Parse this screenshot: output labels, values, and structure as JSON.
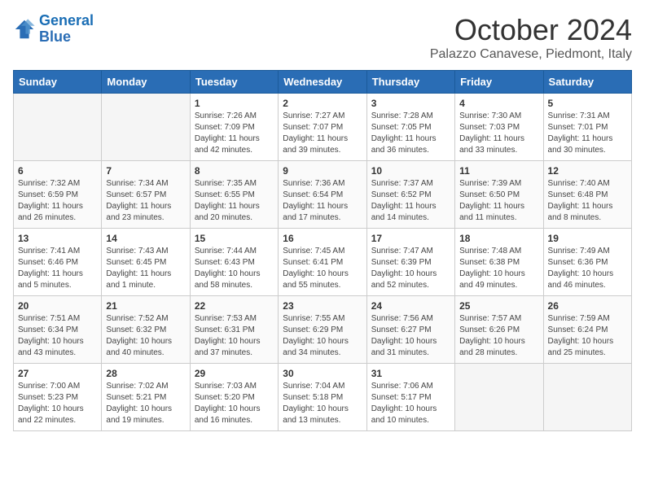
{
  "header": {
    "logo_line1": "General",
    "logo_line2": "Blue",
    "month": "October 2024",
    "location": "Palazzo Canavese, Piedmont, Italy"
  },
  "days_of_week": [
    "Sunday",
    "Monday",
    "Tuesday",
    "Wednesday",
    "Thursday",
    "Friday",
    "Saturday"
  ],
  "weeks": [
    [
      {
        "num": "",
        "empty": true
      },
      {
        "num": "",
        "empty": true
      },
      {
        "num": "1",
        "sunrise": "7:26 AM",
        "sunset": "7:09 PM",
        "daylight": "11 hours and 42 minutes."
      },
      {
        "num": "2",
        "sunrise": "7:27 AM",
        "sunset": "7:07 PM",
        "daylight": "11 hours and 39 minutes."
      },
      {
        "num": "3",
        "sunrise": "7:28 AM",
        "sunset": "7:05 PM",
        "daylight": "11 hours and 36 minutes."
      },
      {
        "num": "4",
        "sunrise": "7:30 AM",
        "sunset": "7:03 PM",
        "daylight": "11 hours and 33 minutes."
      },
      {
        "num": "5",
        "sunrise": "7:31 AM",
        "sunset": "7:01 PM",
        "daylight": "11 hours and 30 minutes."
      }
    ],
    [
      {
        "num": "6",
        "sunrise": "7:32 AM",
        "sunset": "6:59 PM",
        "daylight": "11 hours and 26 minutes."
      },
      {
        "num": "7",
        "sunrise": "7:34 AM",
        "sunset": "6:57 PM",
        "daylight": "11 hours and 23 minutes."
      },
      {
        "num": "8",
        "sunrise": "7:35 AM",
        "sunset": "6:55 PM",
        "daylight": "11 hours and 20 minutes."
      },
      {
        "num": "9",
        "sunrise": "7:36 AM",
        "sunset": "6:54 PM",
        "daylight": "11 hours and 17 minutes."
      },
      {
        "num": "10",
        "sunrise": "7:37 AM",
        "sunset": "6:52 PM",
        "daylight": "11 hours and 14 minutes."
      },
      {
        "num": "11",
        "sunrise": "7:39 AM",
        "sunset": "6:50 PM",
        "daylight": "11 hours and 11 minutes."
      },
      {
        "num": "12",
        "sunrise": "7:40 AM",
        "sunset": "6:48 PM",
        "daylight": "11 hours and 8 minutes."
      }
    ],
    [
      {
        "num": "13",
        "sunrise": "7:41 AM",
        "sunset": "6:46 PM",
        "daylight": "11 hours and 5 minutes."
      },
      {
        "num": "14",
        "sunrise": "7:43 AM",
        "sunset": "6:45 PM",
        "daylight": "11 hours and 1 minute."
      },
      {
        "num": "15",
        "sunrise": "7:44 AM",
        "sunset": "6:43 PM",
        "daylight": "10 hours and 58 minutes."
      },
      {
        "num": "16",
        "sunrise": "7:45 AM",
        "sunset": "6:41 PM",
        "daylight": "10 hours and 55 minutes."
      },
      {
        "num": "17",
        "sunrise": "7:47 AM",
        "sunset": "6:39 PM",
        "daylight": "10 hours and 52 minutes."
      },
      {
        "num": "18",
        "sunrise": "7:48 AM",
        "sunset": "6:38 PM",
        "daylight": "10 hours and 49 minutes."
      },
      {
        "num": "19",
        "sunrise": "7:49 AM",
        "sunset": "6:36 PM",
        "daylight": "10 hours and 46 minutes."
      }
    ],
    [
      {
        "num": "20",
        "sunrise": "7:51 AM",
        "sunset": "6:34 PM",
        "daylight": "10 hours and 43 minutes."
      },
      {
        "num": "21",
        "sunrise": "7:52 AM",
        "sunset": "6:32 PM",
        "daylight": "10 hours and 40 minutes."
      },
      {
        "num": "22",
        "sunrise": "7:53 AM",
        "sunset": "6:31 PM",
        "daylight": "10 hours and 37 minutes."
      },
      {
        "num": "23",
        "sunrise": "7:55 AM",
        "sunset": "6:29 PM",
        "daylight": "10 hours and 34 minutes."
      },
      {
        "num": "24",
        "sunrise": "7:56 AM",
        "sunset": "6:27 PM",
        "daylight": "10 hours and 31 minutes."
      },
      {
        "num": "25",
        "sunrise": "7:57 AM",
        "sunset": "6:26 PM",
        "daylight": "10 hours and 28 minutes."
      },
      {
        "num": "26",
        "sunrise": "7:59 AM",
        "sunset": "6:24 PM",
        "daylight": "10 hours and 25 minutes."
      }
    ],
    [
      {
        "num": "27",
        "sunrise": "7:00 AM",
        "sunset": "5:23 PM",
        "daylight": "10 hours and 22 minutes."
      },
      {
        "num": "28",
        "sunrise": "7:02 AM",
        "sunset": "5:21 PM",
        "daylight": "10 hours and 19 minutes."
      },
      {
        "num": "29",
        "sunrise": "7:03 AM",
        "sunset": "5:20 PM",
        "daylight": "10 hours and 16 minutes."
      },
      {
        "num": "30",
        "sunrise": "7:04 AM",
        "sunset": "5:18 PM",
        "daylight": "10 hours and 13 minutes."
      },
      {
        "num": "31",
        "sunrise": "7:06 AM",
        "sunset": "5:17 PM",
        "daylight": "10 hours and 10 minutes."
      },
      {
        "num": "",
        "empty": true
      },
      {
        "num": "",
        "empty": true
      }
    ]
  ]
}
